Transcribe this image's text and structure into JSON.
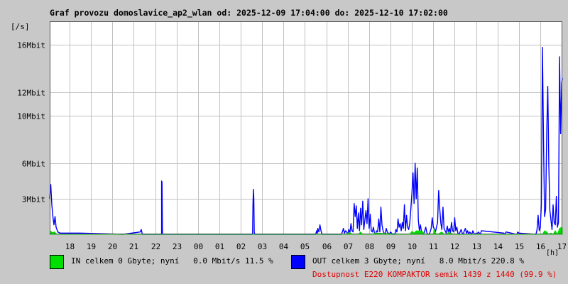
{
  "header": {
    "title": "Graf provozu domoslavice_ap2_wlan od: 2025-12-09 17:04:00 do: 2025-12-10 17:02:00",
    "unit": "[/s]"
  },
  "legend": {
    "in": {
      "text": "IN celkem 0 Gbyte; nyní   0.0 Mbit/s 11.5 %",
      "color": "#00e000"
    },
    "out": {
      "text": "OUT celkem 3 Gbyte; nyní   8.0 Mbit/s 220.8 %",
      "color": "#0000ff"
    },
    "availability": "Dostupnost E220 KOMPAKTOR semik 1439 z 1440 (99.9 %)"
  },
  "chart_data": {
    "type": "area",
    "xlabel": "[h]",
    "ylabel": "[/s]",
    "xlim": [
      17.07,
      41.03
    ],
    "ylim": [
      0,
      18
    ],
    "x_ticks": [
      {
        "h": 18,
        "label": "18"
      },
      {
        "h": 19,
        "label": "19"
      },
      {
        "h": 20,
        "label": "20"
      },
      {
        "h": 21,
        "label": "21"
      },
      {
        "h": 22,
        "label": "22"
      },
      {
        "h": 23,
        "label": "23"
      },
      {
        "h": 24,
        "label": "00"
      },
      {
        "h": 25,
        "label": "01"
      },
      {
        "h": 26,
        "label": "02"
      },
      {
        "h": 27,
        "label": "03"
      },
      {
        "h": 28,
        "label": "04"
      },
      {
        "h": 29,
        "label": "05"
      },
      {
        "h": 30,
        "label": "06"
      },
      {
        "h": 31,
        "label": "07"
      },
      {
        "h": 32,
        "label": "08"
      },
      {
        "h": 33,
        "label": "09"
      },
      {
        "h": 34,
        "label": "10"
      },
      {
        "h": 35,
        "label": "11"
      },
      {
        "h": 36,
        "label": "12"
      },
      {
        "h": 37,
        "label": "13"
      },
      {
        "h": 38,
        "label": "14"
      },
      {
        "h": 39,
        "label": "15"
      },
      {
        "h": 40,
        "label": "16"
      },
      {
        "h": 41,
        "label": "17"
      }
    ],
    "y_ticks": [
      {
        "v": 3,
        "label": "3Mbit"
      },
      {
        "v": 6,
        "label": "6Mbit"
      },
      {
        "v": 10,
        "label": "10Mbit"
      },
      {
        "v": 12,
        "label": "12Mbit"
      },
      {
        "v": 16,
        "label": "16Mbit"
      }
    ],
    "grid": true,
    "series": [
      {
        "name": "OUT",
        "color": "#0000ff",
        "style": "line",
        "x": [
          17.07,
          17.12,
          17.17,
          17.22,
          17.27,
          17.32,
          17.37,
          17.45,
          17.55,
          17.8,
          18.5,
          20.5,
          21.3,
          21.35,
          21.4,
          22.3,
          22.3,
          22.32,
          22.34,
          22.36,
          26.55,
          26.57,
          26.59,
          26.61,
          26.63,
          26.65,
          29.5,
          29.55,
          29.58,
          29.6,
          29.65,
          29.7,
          29.75,
          29.8,
          30.7,
          30.75,
          30.8,
          30.85,
          30.9,
          30.95,
          31.0,
          31.05,
          31.1,
          31.15,
          31.2,
          31.25,
          31.3,
          31.35,
          31.4,
          31.45,
          31.5,
          31.55,
          31.6,
          31.65,
          31.7,
          31.75,
          31.8,
          31.85,
          31.9,
          31.95,
          32.0,
          32.05,
          32.1,
          32.15,
          32.2,
          32.25,
          32.3,
          32.35,
          32.4,
          32.45,
          32.5,
          32.55,
          32.6,
          32.65,
          32.7,
          32.75,
          32.8,
          32.85,
          32.9,
          32.95,
          33.0,
          33.05,
          33.1,
          33.15,
          33.2,
          33.25,
          33.3,
          33.35,
          33.4,
          33.45,
          33.5,
          33.55,
          33.6,
          33.65,
          33.7,
          33.75,
          33.8,
          33.85,
          33.9,
          33.95,
          34.0,
          34.05,
          34.1,
          34.15,
          34.2,
          34.25,
          34.3,
          34.35,
          34.4,
          34.45,
          34.5,
          34.55,
          34.6,
          34.65,
          34.7,
          34.75,
          34.8,
          34.85,
          34.9,
          34.95,
          35.0,
          35.05,
          35.1,
          35.15,
          35.2,
          35.25,
          35.3,
          35.35,
          35.4,
          35.45,
          35.5,
          35.55,
          35.6,
          35.65,
          35.7,
          35.75,
          35.8,
          35.85,
          35.9,
          35.95,
          36.0,
          36.05,
          36.1,
          36.15,
          36.2,
          36.25,
          36.3,
          36.35,
          36.4,
          36.45,
          36.5,
          36.55,
          36.6,
          36.65,
          36.7,
          36.75,
          36.8,
          36.85,
          36.9,
          36.95,
          37.0,
          37.05,
          37.1,
          37.15,
          37.2,
          37.25,
          38.3,
          38.35,
          38.4,
          38.9,
          38.95,
          39.0,
          39.8,
          39.85,
          39.9,
          39.95,
          40.0,
          40.05,
          40.1,
          40.15,
          40.2,
          40.25,
          40.3,
          40.35,
          40.4,
          40.45,
          40.5,
          40.55,
          40.6,
          40.65,
          40.7,
          40.75,
          40.8,
          40.85,
          40.9,
          40.95,
          41.0,
          41.03
        ],
        "y": [
          3.0,
          4.2,
          2.5,
          1.5,
          0.8,
          1.5,
          0.6,
          0.2,
          0.1,
          0.1,
          0.1,
          0,
          0.2,
          0.4,
          0,
          0,
          4.5,
          4.4,
          0,
          0,
          0,
          2.5,
          3.8,
          3.0,
          0.2,
          0,
          0,
          0.3,
          0.1,
          0.5,
          0.2,
          0.8,
          0.3,
          0,
          0,
          0.2,
          0.5,
          0.1,
          0.3,
          0.2,
          0,
          0.4,
          0.1,
          0.9,
          0.3,
          0.2,
          2.6,
          1.5,
          2.4,
          0.5,
          1.8,
          0.3,
          2.2,
          0.8,
          2.8,
          0.4,
          1.2,
          2.0,
          0.9,
          3.0,
          0.5,
          1.7,
          0.3,
          0.2,
          0.6,
          0.1,
          0,
          0.3,
          0.2,
          1.3,
          0.2,
          2.3,
          0.8,
          0.3,
          0.1,
          0,
          0.5,
          0.2,
          0.1,
          0,
          0.2,
          0.1,
          0,
          0,
          0,
          0.4,
          0.2,
          1.3,
          0.6,
          0.9,
          0.3,
          1.0,
          0.5,
          2.5,
          0.3,
          1.6,
          0.6,
          0.4,
          0.9,
          2.2,
          3.5,
          5.2,
          2.6,
          6.0,
          3.0,
          5.6,
          1.2,
          0.3,
          0.8,
          0.2,
          0.1,
          0,
          0.3,
          0.6,
          0.1,
          0,
          0,
          0.2,
          0.5,
          1.4,
          0.6,
          0.5,
          0.2,
          0.6,
          1.0,
          3.7,
          2.2,
          1.0,
          0.4,
          2.3,
          0.5,
          0.3,
          0.1,
          0.7,
          0.2,
          0.5,
          0.1,
          1.0,
          0.3,
          0.2,
          1.4,
          0.3,
          0.6,
          0.1,
          0,
          0.2,
          0.4,
          0.1,
          0,
          0.3,
          0.5,
          0.1,
          0.3,
          0,
          0.2,
          0.1,
          0,
          0.3,
          0.1,
          0,
          0.1,
          0,
          0.2,
          0.1,
          0,
          0.3,
          0.1,
          0,
          0.2,
          0,
          0.2,
          0.1,
          0,
          0.4,
          1.6,
          0.3,
          0.6,
          2.5,
          15.8,
          8.0,
          1.5,
          2.1,
          8.5,
          12.5,
          5.8,
          2.0,
          1.2,
          0.4,
          2.5,
          1.0,
          0.8,
          3.2,
          0.6,
          1.0,
          15.0,
          8.5,
          12.8,
          13.2
        ]
      },
      {
        "name": "IN",
        "color": "#00e000",
        "style": "area",
        "x": [
          17.07,
          17.12,
          17.2,
          17.3,
          17.4,
          30.95,
          31.0,
          31.1,
          31.2,
          31.5,
          31.6,
          31.7,
          32.2,
          32.25,
          33.9,
          34.0,
          34.1,
          34.2,
          34.5,
          34.6,
          34.8,
          35.0,
          35.05,
          35.1,
          35.2,
          35.4,
          35.5,
          35.6,
          35.7,
          36.0,
          36.5,
          40.1,
          40.2,
          40.3,
          40.4,
          40.5,
          40.6,
          40.7,
          40.8,
          40.9,
          41.0,
          41.03
        ],
        "y": [
          0,
          0.25,
          0.15,
          0.2,
          0,
          0,
          0.1,
          0.15,
          0,
          0,
          0.2,
          0,
          0,
          0.1,
          0,
          0.25,
          0.1,
          0.3,
          0.25,
          0,
          0,
          0,
          0.4,
          0.1,
          0,
          0.2,
          0,
          0,
          0.15,
          0,
          0,
          0,
          0.3,
          0.2,
          0,
          0.1,
          0,
          0.3,
          0,
          0.5,
          0.6,
          0.5
        ]
      }
    ]
  }
}
